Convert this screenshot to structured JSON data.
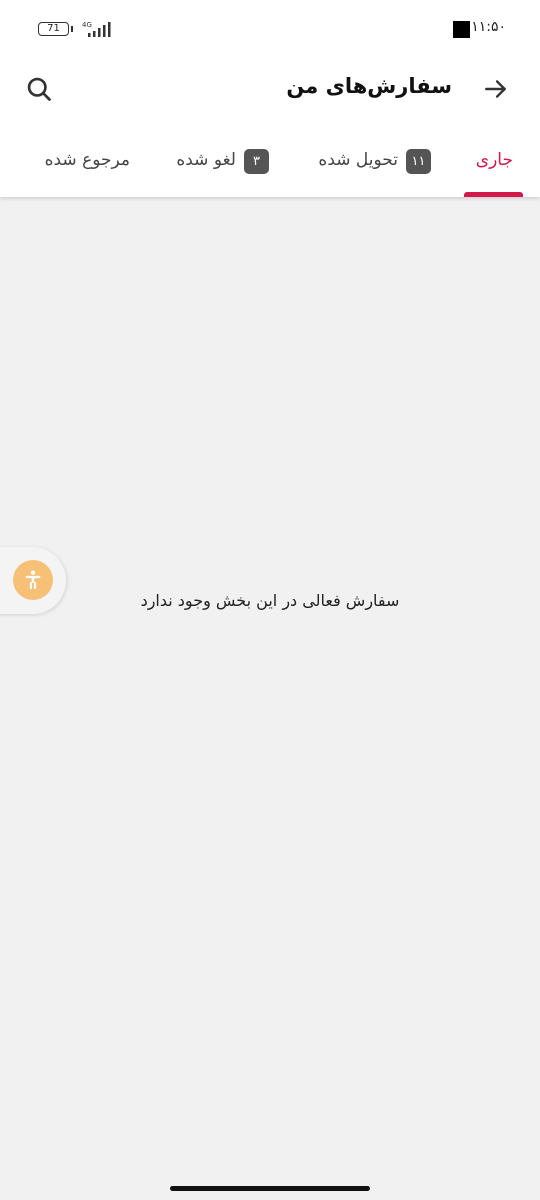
{
  "status_bar": {
    "time": "۱۱:۵۰",
    "battery_level": "71",
    "network": "4G"
  },
  "header": {
    "title": "سفارش‌های من",
    "back_icon": "arrow-right-icon",
    "search_icon": "search-icon"
  },
  "tabs": [
    {
      "label": "جاری",
      "badge": null,
      "active": true
    },
    {
      "label": "تحویل شده",
      "badge": "۱۱",
      "active": false
    },
    {
      "label": "لغو شده",
      "badge": "۳",
      "active": false
    },
    {
      "label": "مرجوع شده",
      "badge": null,
      "active": false
    }
  ],
  "empty_state": {
    "message": "سفارش فعالی در این بخش وجود ندارد"
  },
  "accessibility": {
    "icon": "accessibility-icon"
  },
  "colors": {
    "accent": "#d3194a",
    "badge": "#555555",
    "accessibility_button": "#f6c077",
    "background": "#f1f1f1"
  }
}
